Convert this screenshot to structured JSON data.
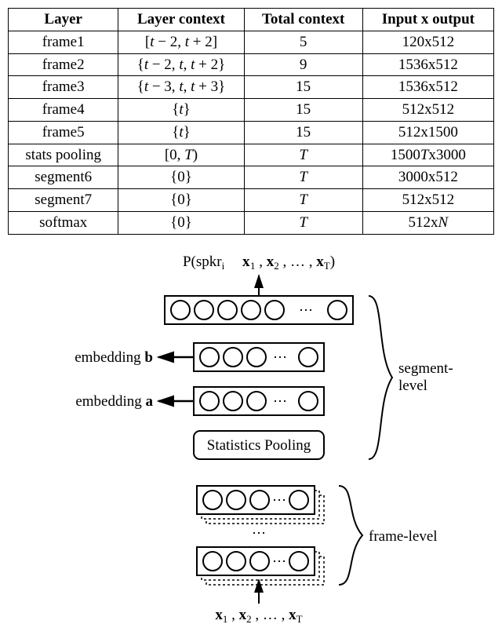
{
  "table": {
    "headers": [
      "Layer",
      "Layer context",
      "Total context",
      "Input x output"
    ],
    "rows": [
      {
        "layer": "frame1",
        "context": "[t − 2, t + 2]",
        "total": "5",
        "io": "120x512"
      },
      {
        "layer": "frame2",
        "context": "{t − 2, t, t + 2}",
        "total": "9",
        "io": "1536x512"
      },
      {
        "layer": "frame3",
        "context": "{t − 3, t, t + 3}",
        "total": "15",
        "io": "1536x512"
      },
      {
        "layer": "frame4",
        "context": "{t}",
        "total": "15",
        "io": "512x512"
      },
      {
        "layer": "frame5",
        "context": "{t}",
        "total": "15",
        "io": "512x1500"
      },
      {
        "layer": "stats pooling",
        "context": "[0, T)",
        "total": "T",
        "io": "1500Tx3000"
      },
      {
        "layer": "segment6",
        "context": "{0}",
        "total": "T",
        "io": "3000x512"
      },
      {
        "layer": "segment7",
        "context": "{0}",
        "total": "T",
        "io": "512x512"
      },
      {
        "layer": "softmax",
        "context": "{0}",
        "total": "T",
        "io": "512xN"
      }
    ]
  },
  "diagram": {
    "top_label_left": "P(spkr",
    "top_label_sub": "i",
    "top_label_right": "x₁ , x₂ , … , x",
    "top_label_T": "T",
    "top_label_close": ")",
    "embedding_b": "embedding b",
    "embedding_a": "embedding a",
    "stats_pooling": "Statistics Pooling",
    "brace_segment": "segment-\nlevel",
    "brace_frame": "frame-level",
    "bottom_inputs": "x₁ , x₂ , … , x",
    "bottom_T": "T",
    "dots": "⋯"
  },
  "chart_data": {
    "type": "table",
    "title": "Network architecture layers",
    "columns": [
      "Layer",
      "Layer context",
      "Total context",
      "Input x output"
    ],
    "rows": [
      [
        "frame1",
        "[t-2, t+2]",
        5,
        "120x512"
      ],
      [
        "frame2",
        "{t-2, t, t+2}",
        9,
        "1536x512"
      ],
      [
        "frame3",
        "{t-3, t, t+3}",
        15,
        "1536x512"
      ],
      [
        "frame4",
        "{t}",
        15,
        "512x512"
      ],
      [
        "frame5",
        "{t}",
        15,
        "512x1500"
      ],
      [
        "stats pooling",
        "[0, T)",
        "T",
        "1500T x 3000"
      ],
      [
        "segment6",
        "{0}",
        "T",
        "3000x512"
      ],
      [
        "segment7",
        "{0}",
        "T",
        "512x512"
      ],
      [
        "softmax",
        "{0}",
        "T",
        "512xN"
      ]
    ]
  }
}
